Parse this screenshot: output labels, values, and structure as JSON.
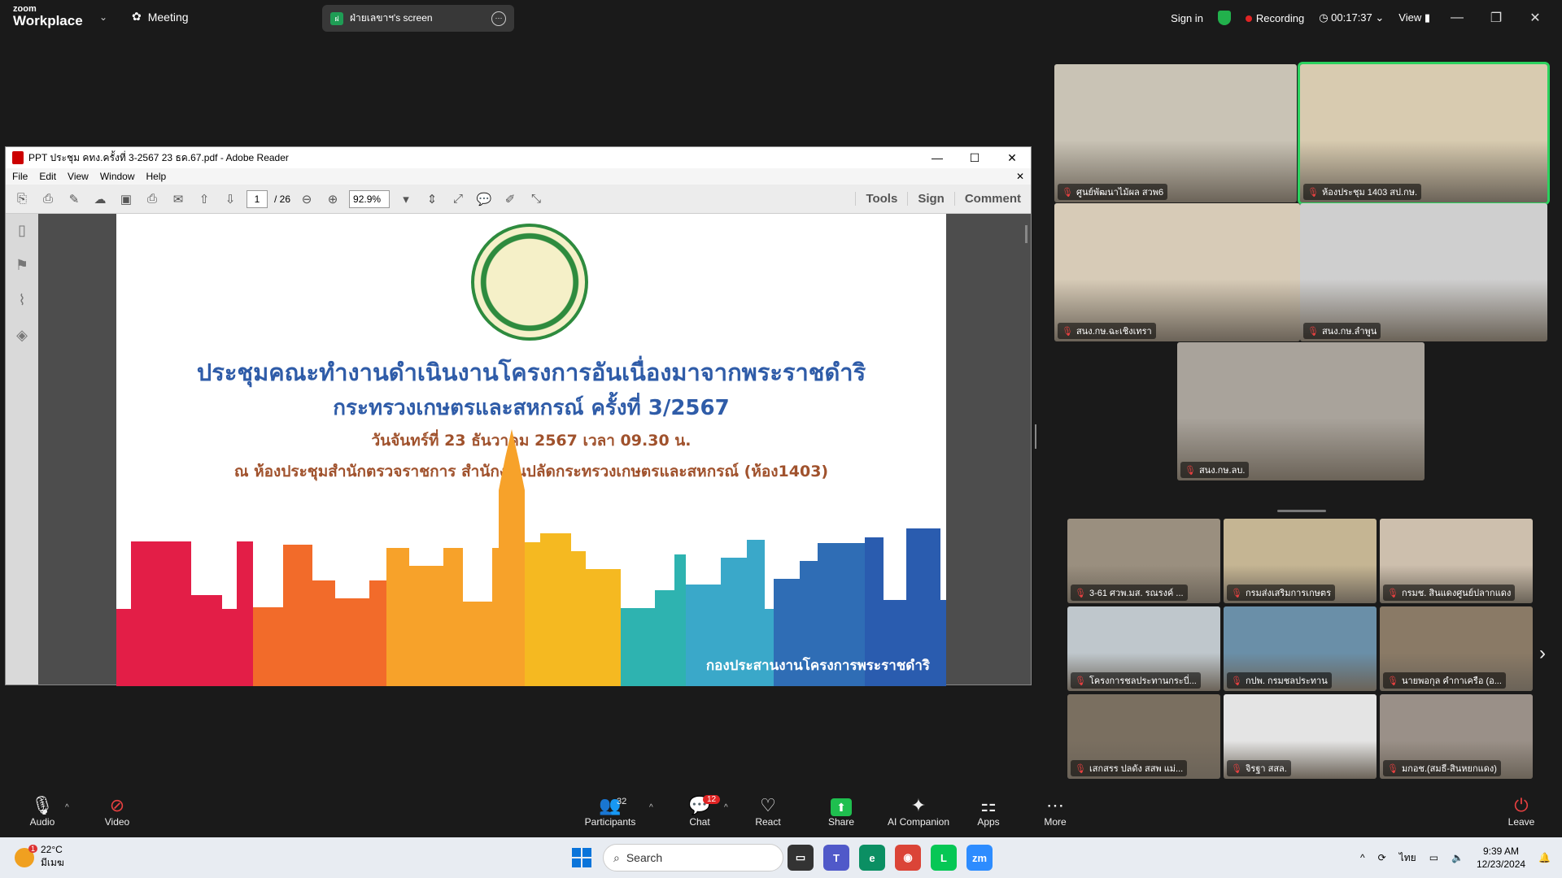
{
  "zoom": {
    "brand_small": "zoom",
    "brand_big": "Workplace",
    "meeting_label": "Meeting",
    "share_name": "ฝ่ายเลขาฯ's screen",
    "share_initial": "ฝ",
    "sign_in": "Sign in",
    "recording": "Recording",
    "timer": "00:17:37",
    "view": "View"
  },
  "reader": {
    "title": "PPT ประชุม คทง.ครั้งที่ 3-2567 23 ธค.67.pdf - Adobe Reader",
    "menu": [
      "File",
      "Edit",
      "View",
      "Window",
      "Help"
    ],
    "page_current": "1",
    "page_total": "/ 26",
    "zoom": "92.9%",
    "right_tools": [
      "Tools",
      "Sign",
      "Comment"
    ]
  },
  "slide": {
    "line1": "ประชุมคณะทำงานดำเนินงานโครงการอันเนื่องมาจากพระราชดำริ",
    "line2": "กระทรวงเกษตรและสหกรณ์ ครั้งที่ 3/2567",
    "line3": "วันจันทร์ที่ 23 ธันวาคม 2567 เวลา 09.30 น.",
    "line4": "ณ ห้องประชุมสำนักตรวจราชการ สำนักงานปลัดกระทรวงเกษตรและสหกรณ์ (ห้อง1403)",
    "footer": "กองประสานงานโครงการพระราชดำริ",
    "city_colors": [
      "#e31e47",
      "#f26b2a",
      "#f7a22a",
      "#f5b921",
      "#2eb3b0",
      "#3aa8c9",
      "#2f6db5",
      "#2a5caf"
    ]
  },
  "participants_top": [
    {
      "name": "ศูนย์พัฒนาไม้ผล สวพ6",
      "bg": "#c9c3b5"
    },
    {
      "name": "ห้องประชุม 1403 สป.กษ.",
      "bg": "#d8cbb0"
    },
    {
      "name": "สนง.กษ.ฉะเชิงเทรา",
      "bg": "#d7cbb7"
    },
    {
      "name": "สนง.กษ.ลำพูน",
      "bg": "#cfcfcf"
    },
    {
      "name": "สนง.กษ.ลบ.",
      "bg": "#a9a39b"
    }
  ],
  "participants_grid": [
    {
      "name": "3-61 ศวพ.มส. รณรงค์ ...",
      "bg": "#9a8f7f"
    },
    {
      "name": "กรมส่งเสริมการเกษตร",
      "bg": "#c5b593"
    },
    {
      "name": "กรมช. สินแดงศูนย์ปลากแดง",
      "bg": "#cdbfad"
    },
    {
      "name": "โครงการชลประทานกระบี่...",
      "bg": "#bfc7cc"
    },
    {
      "name": "กปพ. กรมชลประทาน",
      "bg": "#6a8fa8"
    },
    {
      "name": "นายพอกุล คำกาเครือ (อ...",
      "bg": "#8a7a66"
    },
    {
      "name": "เสกสรร ปลดัง สสพ แม่...",
      "bg": "#7a6f60"
    },
    {
      "name": "จิรฐา สสล.",
      "bg": "#e4e4e4"
    },
    {
      "name": "มกอช.(สมธี-สินหยกแดง)",
      "bg": "#9a9088"
    }
  ],
  "toolbar": {
    "audio": "Audio",
    "video": "Video",
    "participants": "Participants",
    "participants_count": "32",
    "chat": "Chat",
    "chat_badge": "12",
    "react": "React",
    "share": "Share",
    "ai": "AI Companion",
    "apps": "Apps",
    "more": "More",
    "leave": "Leave"
  },
  "taskbar": {
    "temp": "22°C",
    "weather_text": "มีเมฆ",
    "weather_badge": "1",
    "search": "Search",
    "lang": "ไทย",
    "time": "9:39 AM",
    "date": "12/23/2024"
  }
}
